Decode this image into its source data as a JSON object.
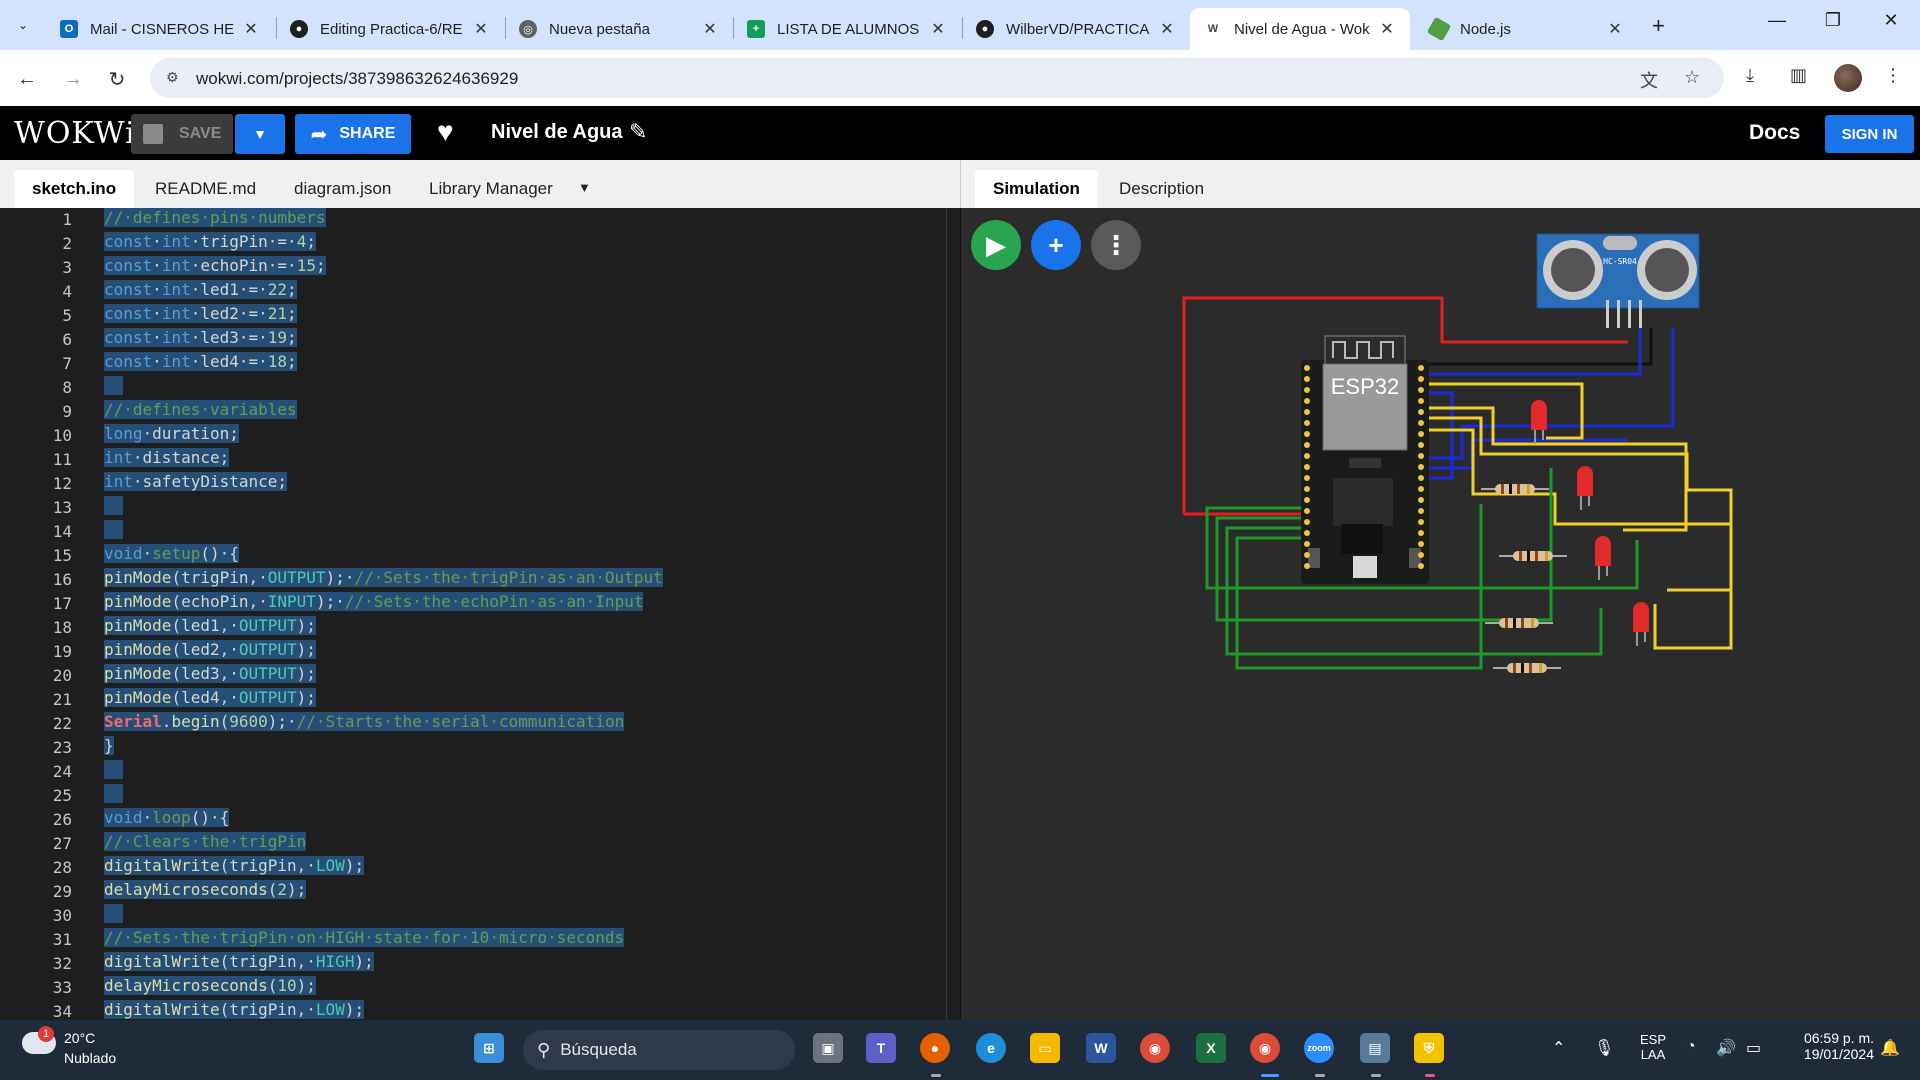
{
  "browser": {
    "tabs": [
      {
        "title": "Mail - CISNEROS HEI",
        "icon": "outlook-icon",
        "color": "#0f6cbd"
      },
      {
        "title": "Editing Practica-6/RE",
        "icon": "github-icon",
        "color": "#1f1f1f"
      },
      {
        "title": "Nueva pestaña",
        "icon": "chrome-icon",
        "color": "#5f6368"
      },
      {
        "title": "LISTA DE ALUMNOS",
        "icon": "sheets-icon",
        "color": "#0f9d58"
      },
      {
        "title": "WilberVD/PRACTICA",
        "icon": "github-icon",
        "color": "#1f1f1f"
      },
      {
        "title": "Nivel de Agua - Wok",
        "icon": "wokwi-icon",
        "color": "#ffffff"
      },
      {
        "title": "Node.js",
        "icon": "nodejs-icon",
        "color": "#539e43"
      }
    ],
    "url": "wokwi.com/projects/387398632624636929"
  },
  "wokwi": {
    "logo": "WOKWi",
    "save_label": "SAVE",
    "share_label": "SHARE",
    "project_name": "Nivel de Agua",
    "docs_label": "Docs",
    "signin_label": "SIGN IN",
    "editor_tabs": [
      "sketch.ino",
      "README.md",
      "diagram.json",
      "Library Manager"
    ],
    "sim_tabs": [
      "Simulation",
      "Description"
    ]
  },
  "code": {
    "line_numbers": [
      "1",
      "2",
      "3",
      "4",
      "5",
      "6",
      "7",
      "8",
      "9",
      "10",
      "11",
      "12",
      "13",
      "14",
      "15",
      "16",
      "17",
      "18",
      "19",
      "20",
      "21",
      "22",
      "23",
      "24",
      "25",
      "26",
      "27",
      "28",
      "29",
      "30",
      "31",
      "32",
      "33",
      "34"
    ]
  },
  "simulation": {
    "board_label": "ESP32",
    "sensor_label": "HC-SR04",
    "wire_colors": {
      "red": "#e02020",
      "black": "#111111",
      "blue": "#1a2ad8",
      "yellow": "#f2d02a",
      "green": "#1f9a2a"
    }
  },
  "taskbar": {
    "weather_temp": "20°C",
    "weather_cond": "Nublado",
    "weather_badge": "1",
    "search_label": "Búsqueda",
    "lang_top": "ESP",
    "lang_bottom": "LAA",
    "time": "06:59 p. m.",
    "date": "19/01/2024"
  }
}
